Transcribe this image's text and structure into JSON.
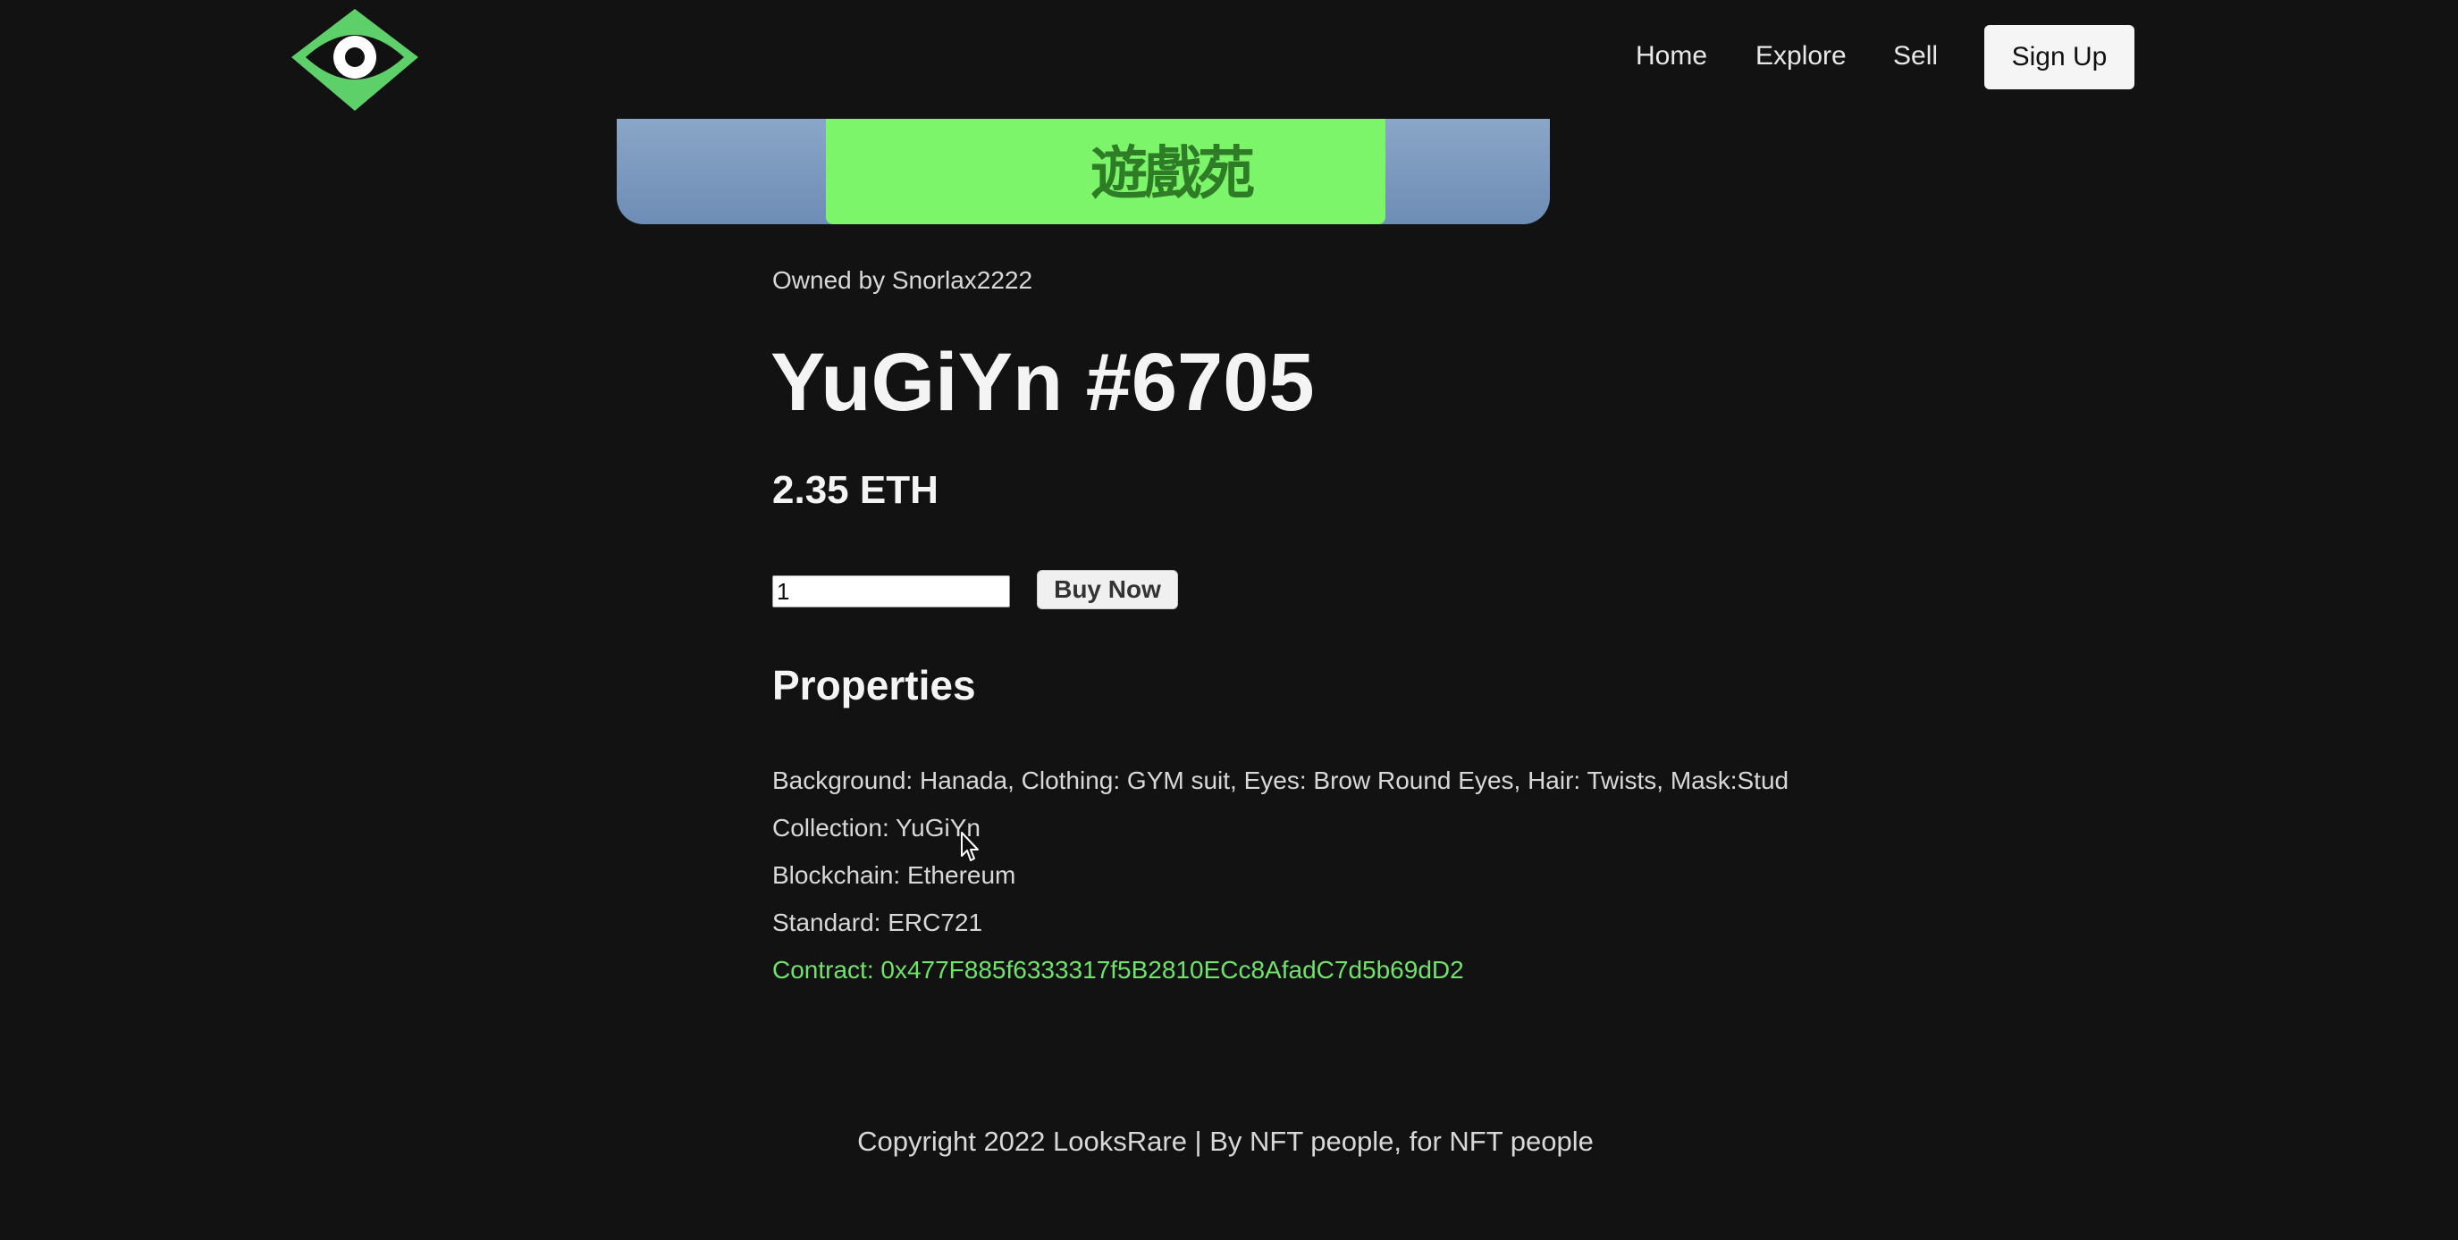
{
  "header": {
    "logo_icon": "eye-logo-icon",
    "nav": {
      "home": "Home",
      "explore": "Explore",
      "sell": "Sell",
      "signup": "Sign Up"
    }
  },
  "item": {
    "image_text": "遊戲苑",
    "owner": "Owned by Snorlax2222",
    "title": "YuGiYn #6705",
    "price": "2.35 ETH",
    "quantity_value": "1",
    "buy_label": "Buy Now"
  },
  "properties": {
    "heading": "Properties",
    "attributes": "Background: Hanada, Clothing: GYM suit, Eyes: Brow Round Eyes, Hair: Twists, Mask:Stud",
    "collection": "Collection: YuGiYn",
    "blockchain": "Blockchain: Ethereum",
    "standard": "Standard: ERC721",
    "contract": "Contract: 0x477F885f6333317f5B2810ECc8AfadC7d5b69dD2"
  },
  "footer": {
    "text": "Copyright 2022 LooksRare | By NFT people, for NFT people"
  },
  "colors": {
    "background": "#121212",
    "accent_green": "#6fe36a",
    "logo_green": "#5ed06a"
  }
}
